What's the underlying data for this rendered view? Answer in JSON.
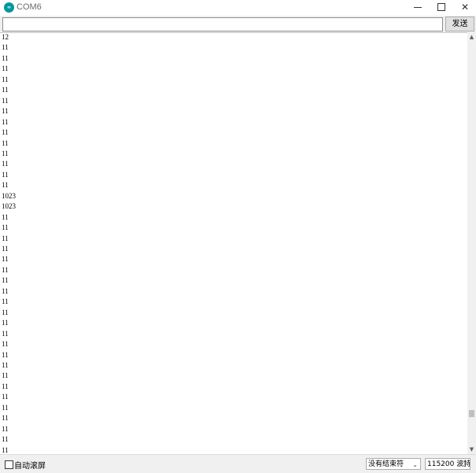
{
  "window": {
    "title": "COM6",
    "icon_text": "∞",
    "minimize_glyph": "",
    "close_glyph": "✕"
  },
  "send": {
    "input_value": "",
    "button_label": "发送"
  },
  "output": {
    "lines": [
      "12",
      "11",
      "11",
      "11",
      "11",
      "11",
      "11",
      "11",
      "11",
      "11",
      "11",
      "11",
      "11",
      "11",
      "11",
      "1023",
      "1023",
      "11",
      "11",
      "11",
      "11",
      "11",
      "11",
      "11",
      "11",
      "11",
      "11",
      "11",
      "11",
      "11",
      "11",
      "11",
      "11",
      "11",
      "11",
      "11",
      "11",
      "11",
      "11",
      "11",
      "11",
      "11"
    ]
  },
  "scrollbar": {
    "up_glyph": "▲",
    "down_glyph": "▼"
  },
  "bottom": {
    "autoscroll_label": "自动滚屏",
    "autoscroll_checked": false,
    "line_ending": "没有结束符",
    "baud_rate": "115200 波特",
    "chevron": "⌄"
  }
}
